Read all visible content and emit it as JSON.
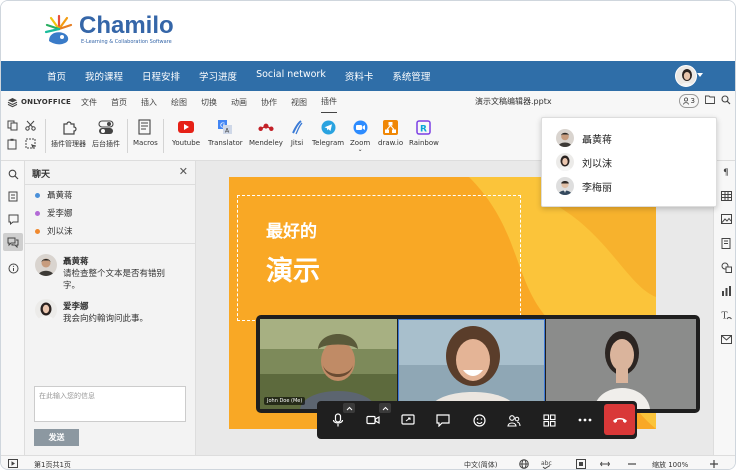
{
  "chamilo": {
    "logo_name": "Chamilo",
    "logo_tagline": "E-Learning & Collaboration Software",
    "nav": [
      "首页",
      "我的课程",
      "日程安排",
      "学习进度",
      "Social network",
      "资料卡",
      "系统管理"
    ]
  },
  "onlyoffice": {
    "brand": "ONLYOFFICE",
    "tabs": [
      "文件",
      "首页",
      "插入",
      "绘图",
      "切换",
      "动画",
      "协作",
      "视图",
      "插件"
    ],
    "active_tab": "插件",
    "doc_name": "演示文稿编辑器.pptx",
    "users_count": "3",
    "ribbon": {
      "plugin_manager": "插件管理器",
      "background_plugins": "后台插件",
      "macros": "Macros",
      "youtube": "Youtube",
      "translator": "Translator",
      "mendeley": "Mendeley",
      "jitsi": "Jitsi",
      "telegram": "Telegram",
      "zoom": "Zoom",
      "drawio": "draw.io",
      "rainbow": "Rainbow"
    }
  },
  "chat": {
    "title": "聊天",
    "users": [
      {
        "name": "聶黄蒋",
        "color": "#4a90d9"
      },
      {
        "name": "爱李娜",
        "color": "#b36bd6"
      },
      {
        "name": "刘以沫",
        "color": "#f0892e"
      }
    ],
    "messages": [
      {
        "name": "聶黄蒋",
        "text": "请检查整个文本是否有错别字。"
      },
      {
        "name": "爱李娜",
        "text": "我会向约翰询问此事。"
      }
    ],
    "input_placeholder": "在此输入您的信息",
    "send_label": "发送"
  },
  "slide": {
    "line1": "最好的",
    "line2": "演示"
  },
  "video": {
    "self_label": "John Doe (Me)"
  },
  "participants": [
    "聶黄蒋",
    "刘以沫",
    "李梅丽"
  ],
  "status": {
    "page": "第1页共1页",
    "language": "中文(简体)",
    "zoom": "缩放 100%"
  },
  "colors": {
    "nav_bg": "#2f6ea8",
    "slide_bg": "#f9a825",
    "end_call": "#d93838"
  }
}
